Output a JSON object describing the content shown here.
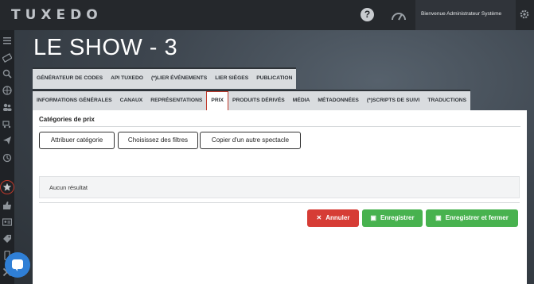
{
  "app": {
    "logo": "TUXEDO"
  },
  "header": {
    "user_name": "Bienvenue Administrateur Système"
  },
  "page": {
    "title": "LE SHOW - 3"
  },
  "tabs_row1": [
    "GÉNÉRATEUR DE CODES",
    "API TUXEDO",
    "(*)LIER ÉVÉNEMENTS",
    "LIER SIÈGES",
    "PUBLICATION"
  ],
  "tabs_row2": [
    "INFORMATIONS GÉNÉRALES",
    "CANAUX",
    "REPRÉSENTATIONS",
    "PRIX",
    "PRODUITS DÉRIVÉS",
    "MÉDIA",
    "MÉTADONNÉES",
    "(*)SCRIPTS DE SUIVI",
    "TRADUCTIONS"
  ],
  "active_tab": "PRIX",
  "panel": {
    "title": "Catégories de prix",
    "buttons": [
      "Attribuer catégorie",
      "Choisissez des filtres",
      "Copier d'un autre spectacle"
    ],
    "empty_text": "Aucun résultat"
  },
  "actions": {
    "cancel": "Annuler",
    "save": "Enregistrer",
    "save_close": "Enregistrer et fermer"
  },
  "colors": {
    "danger": "#d63c35",
    "success": "#48b24f",
    "accent": "#2f7fd6"
  }
}
